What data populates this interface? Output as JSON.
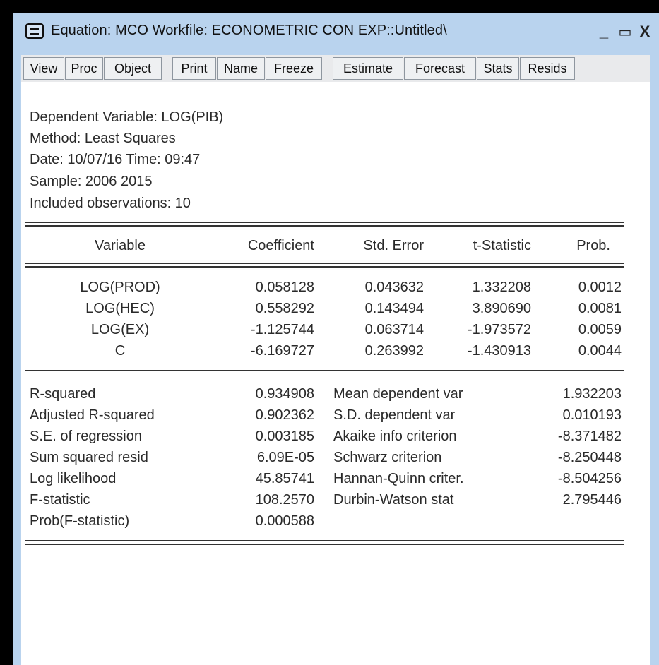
{
  "window": {
    "title": "Equation: MCO   Workfile: ECONOMETRIC CON EXP::Untitled\\",
    "controls": {
      "minimize": "_",
      "maximize": "▭",
      "close": "X"
    }
  },
  "toolbar": {
    "view": "View",
    "proc": "Proc",
    "object": "Object",
    "print": "Print",
    "name": "Name",
    "freeze": "Freeze",
    "estimate": "Estimate",
    "forecast": "Forecast",
    "stats": "Stats",
    "resids": "Resids"
  },
  "header": {
    "dependent": "Dependent Variable: LOG(PIB)",
    "method": "Method: Least Squares",
    "date": "Date: 10/07/16   Time: 09:47",
    "sample": "Sample: 2006 2015",
    "observations": "Included observations: 10"
  },
  "coef_table": {
    "columns": [
      "Variable",
      "Coefficient",
      "Std. Error",
      "t-Statistic",
      "Prob."
    ],
    "rows": [
      [
        "LOG(PROD)",
        "0.058128",
        "0.043632",
        "1.332208",
        "0.0012"
      ],
      [
        "LOG(HEC)",
        "0.558292",
        "0.143494",
        "3.890690",
        "0.0081"
      ],
      [
        "LOG(EX)",
        "-1.125744",
        "0.063714",
        "-1.973572",
        "0.0059"
      ],
      [
        "C",
        "-6.169727",
        "0.263992",
        "-1.430913",
        "0.0044"
      ]
    ]
  },
  "stats": {
    "left": [
      [
        "R-squared",
        "0.934908"
      ],
      [
        "Adjusted R-squared",
        "0.902362"
      ],
      [
        "S.E. of regression",
        "0.003185"
      ],
      [
        "Sum squared resid",
        "6.09E-05"
      ],
      [
        "Log likelihood",
        "45.85741"
      ],
      [
        "F-statistic",
        "108.2570"
      ],
      [
        "Prob(F-statistic)",
        "0.000588"
      ]
    ],
    "right": [
      [
        "Mean dependent var",
        "1.932203"
      ],
      [
        "S.D. dependent var",
        "0.010193"
      ],
      [
        "Akaike info criterion",
        "-8.371482"
      ],
      [
        "Schwarz criterion",
        "-8.250448"
      ],
      [
        "Hannan-Quinn criter.",
        "-8.504256"
      ],
      [
        "Durbin-Watson stat",
        "2.795446"
      ]
    ]
  },
  "colors": {
    "titlebar": "#b9d3ee",
    "toolbar": "#e9eaec",
    "content": "#ffffff",
    "text": "#2a2a2a"
  }
}
